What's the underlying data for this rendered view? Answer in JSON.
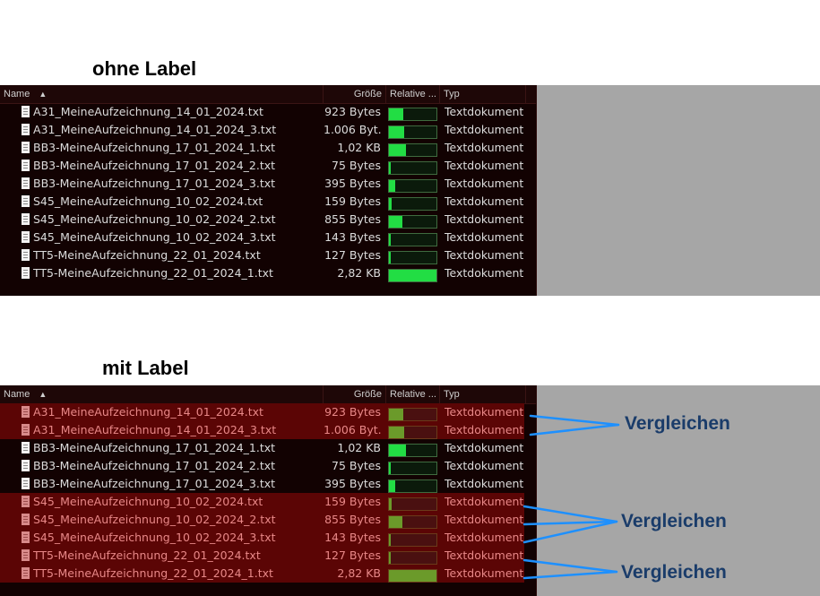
{
  "headings": {
    "top": "ohne Label",
    "bottom": "mit Label"
  },
  "columns": {
    "name": "Name",
    "size": "Größe",
    "relative": "Relative ...",
    "type": "Typ"
  },
  "colors": {
    "highlight_row": "#5b0505",
    "bar_fill": "#22dd44",
    "annotation": "#1a3c6a",
    "arrow": "#1e90ff"
  },
  "files": [
    {
      "name": "A31_MeineAufzeichnung_14_01_2024.txt",
      "size": "923 Bytes",
      "relative": 0.3,
      "type": "Textdokument"
    },
    {
      "name": "A31_MeineAufzeichnung_14_01_2024_3.txt",
      "size": "1.006 Byt...",
      "relative": 0.33,
      "type": "Textdokument"
    },
    {
      "name": "BB3-MeineAufzeichnung_17_01_2024_1.txt",
      "size": "1,02 KB",
      "relative": 0.36,
      "type": "Textdokument"
    },
    {
      "name": "BB3-MeineAufzeichnung_17_01_2024_2.txt",
      "size": "75 Bytes",
      "relative": 0.02,
      "type": "Textdokument"
    },
    {
      "name": "BB3-MeineAufzeichnung_17_01_2024_3.txt",
      "size": "395 Bytes",
      "relative": 0.13,
      "type": "Textdokument"
    },
    {
      "name": "S45_MeineAufzeichnung_10_02_2024.txt",
      "size": "159 Bytes",
      "relative": 0.05,
      "type": "Textdokument"
    },
    {
      "name": "S45_MeineAufzeichnung_10_02_2024_2.txt",
      "size": "855 Bytes",
      "relative": 0.28,
      "type": "Textdokument"
    },
    {
      "name": "S45_MeineAufzeichnung_10_02_2024_3.txt",
      "size": "143 Bytes",
      "relative": 0.04,
      "type": "Textdokument"
    },
    {
      "name": "TT5-MeineAufzeichnung_22_01_2024.txt",
      "size": "127 Bytes",
      "relative": 0.03,
      "type": "Textdokument"
    },
    {
      "name": "TT5-MeineAufzeichnung_22_01_2024_1.txt",
      "size": "2,82 KB",
      "relative": 1.0,
      "type": "Textdokument"
    }
  ],
  "labeled_rows": [
    true,
    true,
    false,
    false,
    false,
    true,
    true,
    true,
    true,
    true
  ],
  "annotations": [
    "Vergleichen",
    "Vergleichen",
    "Vergleichen"
  ]
}
